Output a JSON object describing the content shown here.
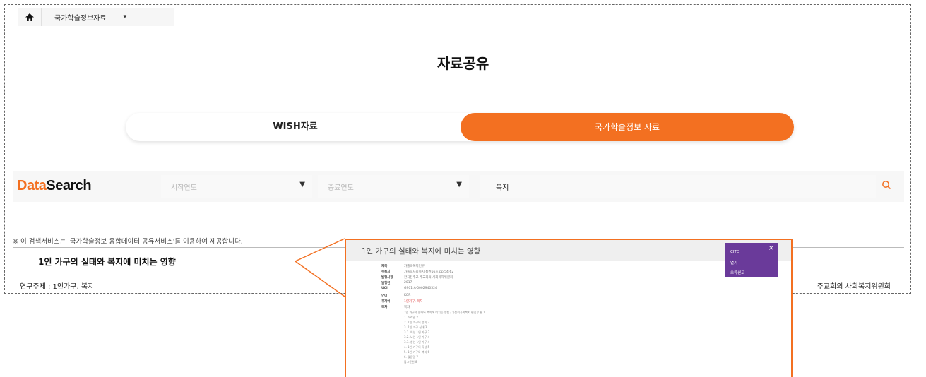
{
  "breadcrumb": {
    "label": "국가학술정보자료"
  },
  "page_title": "자료공유",
  "tabs": {
    "wish": "WISH자료",
    "national": "국가학술정보 자료"
  },
  "search": {
    "logo_data": "Data",
    "logo_search": "Search",
    "start_year_placeholder": "시작연도",
    "end_year_placeholder": "종료연도",
    "keyword": "복지"
  },
  "notice": "※ 이 검색서비스는 '국가학술정보 융합데이터 공유서비스'를 이용하여 제공합니다.",
  "result": {
    "title": "1인 가구의 실태와 복지에 미치는 영향",
    "subject": "연구주제 : 1인가구, 복지",
    "publisher_tail": "주교회의 사회복지위원회"
  },
  "popup": {
    "title": "1인 가구의 실태와 복지에 미치는 영향",
    "menu": [
      "CITE",
      "열기",
      "오류신고"
    ],
    "close": "×",
    "fields": [
      {
        "key": "제목",
        "value": "가톨릭복지연구"
      },
      {
        "key": "수록지",
        "value": "가톨릭사회복지 통권56호 pp.54-62"
      },
      {
        "key": "발행사항",
        "value": "한국천주교 주교회의 사회복지위원회"
      },
      {
        "key": "발행년",
        "value": "2017"
      },
      {
        "key": "UCI",
        "value": "G901:A-0002940524"
      },
      {
        "key": "언어",
        "value": "KOR"
      },
      {
        "key": "주제어",
        "value": "1인가구, 복지"
      },
      {
        "key": "목차",
        "value": "목차"
      }
    ],
    "toc": [
      "1인 가구의 실태와 복지에 미치는 영향 / 가톨릭사회복지 편집부 편 1",
      "1. 머리말 2",
      "2. 1인 가구의 정의 3",
      "3. 1인 가구 실태 3",
      "3.1. 여성 1인 가구 3",
      "3.2. 노인 1인 가구 4",
      "3.3. 청년 1인 가구 4",
      "4. 1인 가구의 특성 5",
      "5. 1인 가구와 복지 6",
      "6. 맺음말 7",
      "참고문헌 8"
    ]
  },
  "colors": {
    "accent": "#f37021",
    "menu": "#6a3a9a"
  },
  "icons": {
    "home": "home-icon",
    "search": "search-icon",
    "caret": "chevron-down-icon"
  }
}
